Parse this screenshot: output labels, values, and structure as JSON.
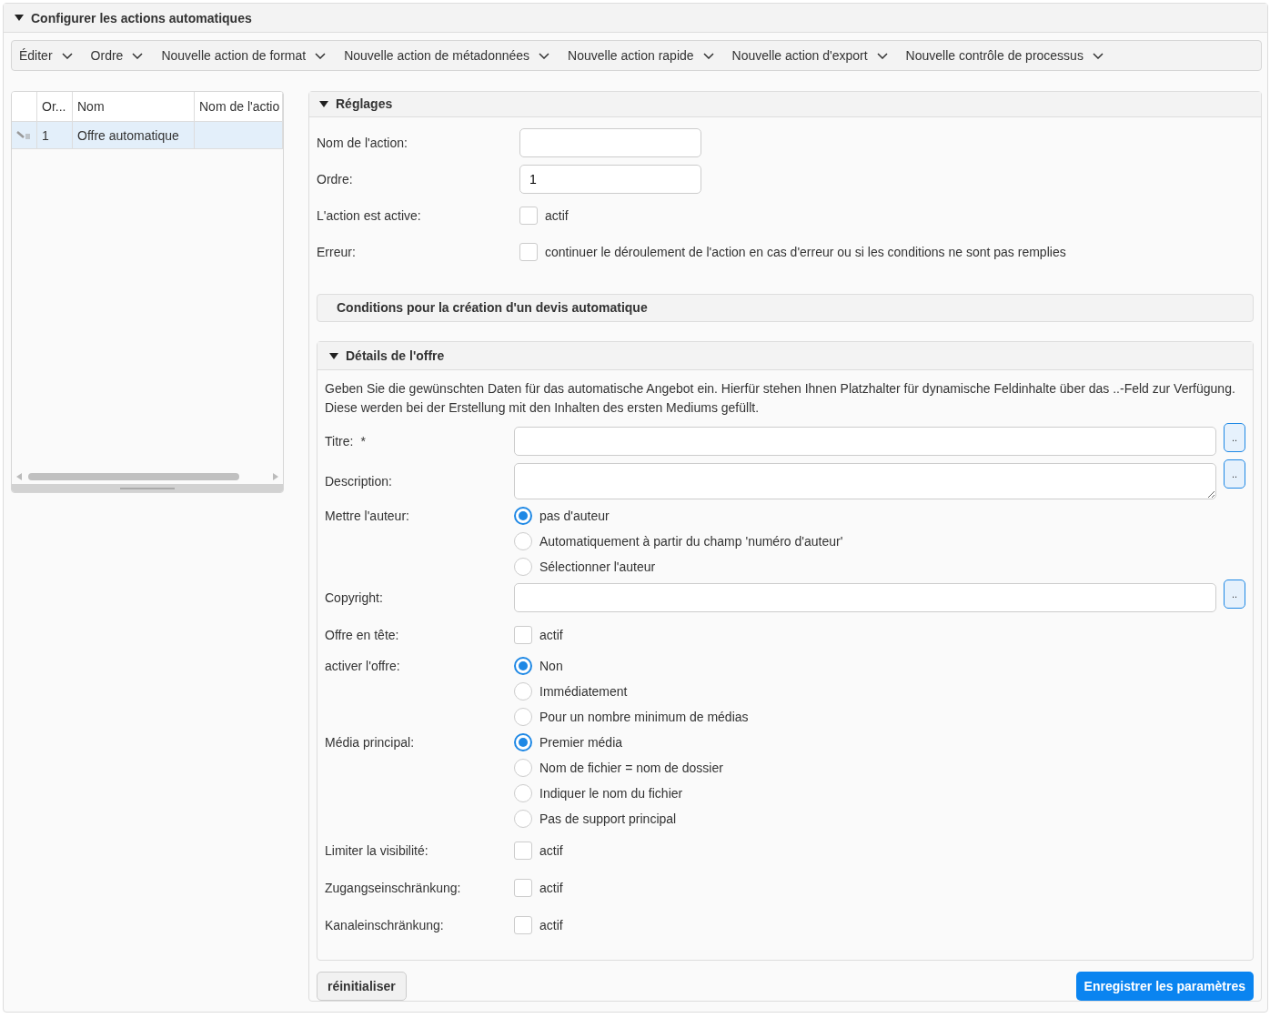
{
  "panel": {
    "title": "Configurer les actions automatiques",
    "expanded": true
  },
  "toolbar": {
    "menus": [
      "Éditer",
      "Ordre",
      "Nouvelle action de format",
      "Nouvelle action de métadonnées",
      "Nouvelle action rapide",
      "Nouvelle action d'export",
      "Nouvelle contrôle de processus"
    ]
  },
  "table": {
    "columns": [
      "Or...",
      "Nom",
      "Nom de l'actio"
    ],
    "rows": [
      {
        "cells": [
          "1",
          "Offre automatique"
        ],
        "selected": true
      }
    ]
  },
  "settings": {
    "title": "Réglages",
    "expanded": true,
    "fields": [
      {
        "kind": "text",
        "label": "Nom de l'action:"
      },
      {
        "kind": "text",
        "label": "Ordre:",
        "value": "1"
      },
      {
        "kind": "checkbox",
        "label": "L'action est active:",
        "text": "actif",
        "checked": false
      },
      {
        "kind": "checkbox",
        "label": "Erreur:",
        "text": "continuer le déroulement de l'action en cas d'erreur ou si les conditions ne sont pas remplies",
        "checked": false
      }
    ]
  },
  "conditions": {
    "title": "Conditions pour la création d'un devis automatique"
  },
  "details": {
    "title": "Détails de l'offre",
    "expanded": true,
    "intro": "Geben Sie die gewünschten Daten für das automatische Angebot ein. Hierfür stehen Ihnen Platzhalter für dynamische Feldinhalte über das ..-Feld zur Verfügung. Diese werden bei der Erstellung mit den Inhalten des ersten Mediums gefüllt.",
    "fields": [
      {
        "kind": "text",
        "label": "Titre:",
        "marker": "*",
        "button": ".."
      },
      {
        "kind": "textarea",
        "label": "Description:",
        "button": ".."
      },
      {
        "kind": "radio",
        "label": "Mettre l'auteur:",
        "options": [
          {
            "label": "pas d'auteur",
            "selected": true
          },
          {
            "label": "Automatiquement à partir du champ 'numéro d'auteur'",
            "selected": false
          },
          {
            "label": "Sélectionner l'auteur",
            "selected": false
          }
        ]
      },
      {
        "kind": "text",
        "label": "Copyright:",
        "button": ".."
      },
      {
        "kind": "checkbox",
        "label": "Offre en tête:",
        "text": "actif",
        "checked": false
      },
      {
        "kind": "radio",
        "label": "activer l'offre:",
        "options": [
          {
            "label": "Non",
            "selected": true
          },
          {
            "label": "Immédiatement",
            "selected": false
          },
          {
            "label": "Pour un nombre minimum de médias",
            "selected": false
          }
        ]
      },
      {
        "kind": "radio",
        "label": "Média principal:",
        "options": [
          {
            "label": "Premier média",
            "selected": true
          },
          {
            "label": "Nom de fichier = nom de dossier",
            "selected": false
          },
          {
            "label": "Indiquer le nom du fichier",
            "selected": false
          },
          {
            "label": "Pas de support principal",
            "selected": false
          }
        ]
      },
      {
        "kind": "checkbox",
        "label": "Limiter la visibilité:",
        "text": "actif",
        "checked": false
      },
      {
        "kind": "checkbox",
        "label": "Zugangseinschränkung:",
        "text": "actif",
        "checked": false
      },
      {
        "kind": "checkbox",
        "label": "Kanaleinschränkung:",
        "text": "actif",
        "checked": false
      }
    ]
  },
  "buttons": {
    "reset": "réinitialiser",
    "save": "Enregistrer les paramètres"
  }
}
